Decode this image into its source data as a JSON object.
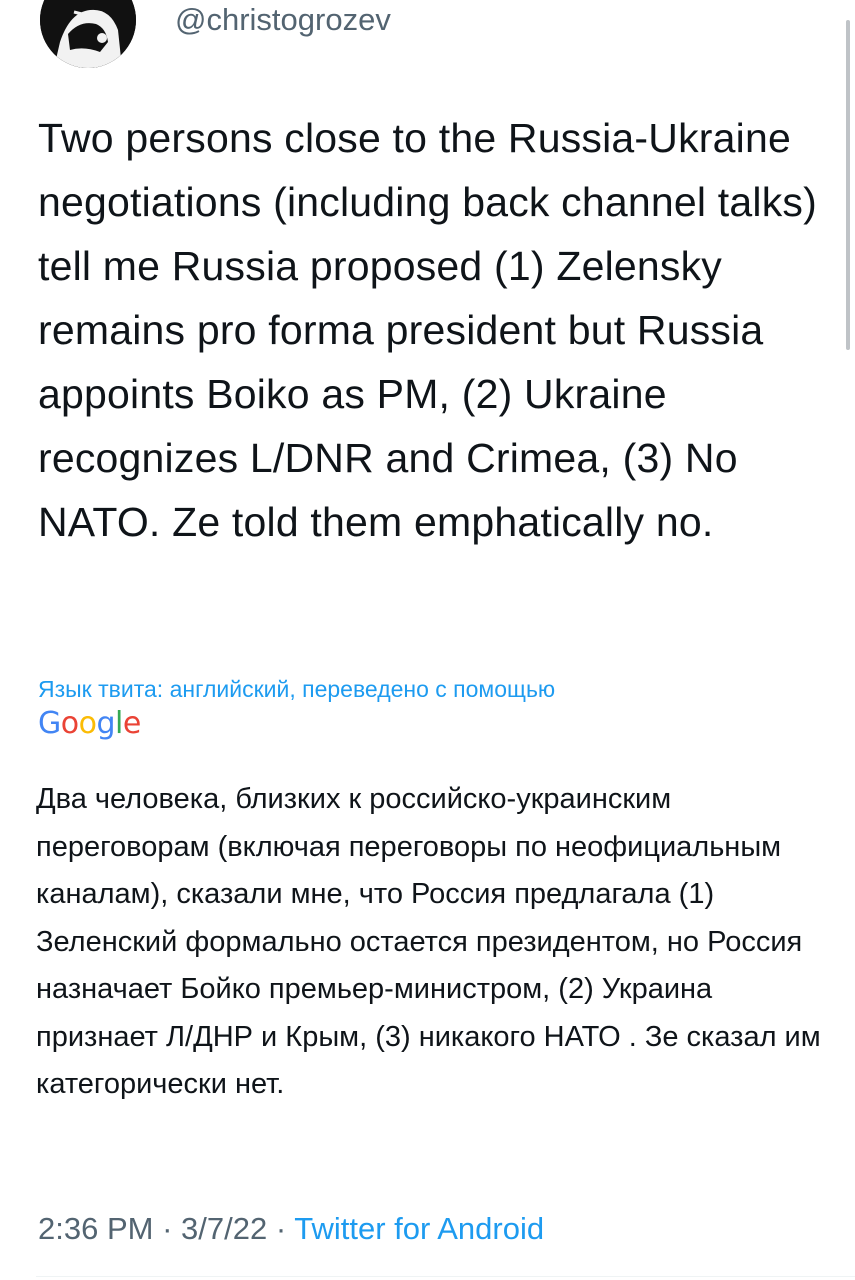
{
  "tweet": {
    "handle": "@christogrozev",
    "text": "Two persons close to the Russia-Ukraine negotiations (including back channel talks) tell me Russia proposed (1) Zelensky remains pro forma president but Russia appoints Boiko as PM, (2) Ukraine recognizes L/DNR and Crimea, (3) No NATO. Ze told them emphatically no.",
    "translation_note": "Язык твита: английский, переведено с помощью",
    "translation_provider": "Google",
    "translated_text": "Два человека, близких к российско-украинским переговорам (включая переговоры по неофициальным каналам), сказали мне, что Россия предлагала (1) Зеленский формально остается президентом, но Россия назначает Бойко премьер-министром, (2) Украина признает Л/ДНР и Крым, (3) никакого НАТО . Зе сказал им категорически нет.",
    "time": "2:36 PM",
    "separator": "·",
    "date": "3/7/22",
    "source": "Twitter for Android"
  },
  "icons": {
    "avatar": "avatar-portrait-icon"
  },
  "colors": {
    "text": "#0f1419",
    "secondary": "#536471",
    "link": "#1d9bf0",
    "google_blue": "#4285f4",
    "google_red": "#ea4335",
    "google_yellow": "#fbbc05",
    "google_green": "#34a853"
  }
}
